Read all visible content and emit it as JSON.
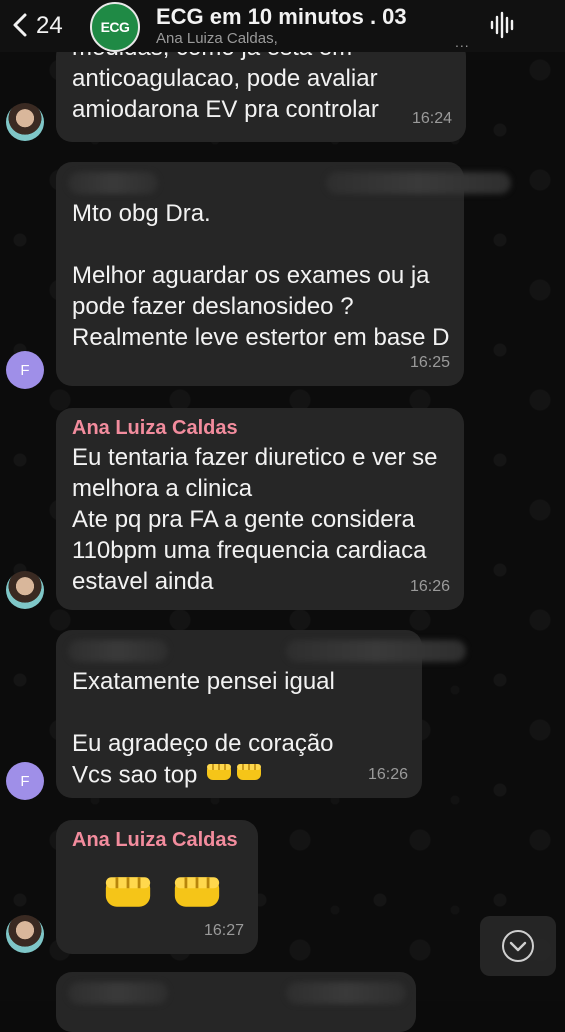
{
  "header": {
    "back_count": "24",
    "group_avatar_text": "ECG",
    "title": "ECG em 10 minutos . 03",
    "subtitle": "Ana Luiza Caldas,",
    "more": "..."
  },
  "messages": [
    {
      "id": "m1",
      "lines": [
        "medidas, como ja esta em",
        "anticoagulacao, pode avaliar",
        "amiodarona EV pra controlar"
      ],
      "time": "16:24"
    },
    {
      "id": "m2",
      "avatar_letter": "F",
      "lines": [
        "Mto obg Dra.",
        "",
        "Melhor aguardar os exames ou ja",
        "pode fazer deslanosideo ?",
        "Realmente leve estertor em base D"
      ],
      "time": "16:25"
    },
    {
      "id": "m3",
      "sender": "Ana Luiza Caldas",
      "lines": [
        "Eu tentaria fazer diuretico e ver se",
        "melhora a clinica",
        "Ate pq pra FA a gente considera",
        "110bpm uma frequencia cardiaca",
        "estavel ainda"
      ],
      "time": "16:26"
    },
    {
      "id": "m4",
      "avatar_letter": "F",
      "lines": [
        "Exatamente pensei igual",
        "",
        "Eu agradeço de coração",
        "Vcs sao top"
      ],
      "time": "16:26"
    },
    {
      "id": "m5",
      "sender": "Ana Luiza Caldas",
      "time": "16:27"
    }
  ],
  "icons": {
    "back": "chevron-left-icon",
    "voice": "waveform-icon",
    "scroll_down": "chevron-down-icon",
    "reaction": "fist-emoji"
  },
  "colors": {
    "bubble": "#262626",
    "sender_name": "#f28c9d",
    "avatar_f": "#9f8fe8",
    "group_avatar": "#1f8a45"
  }
}
